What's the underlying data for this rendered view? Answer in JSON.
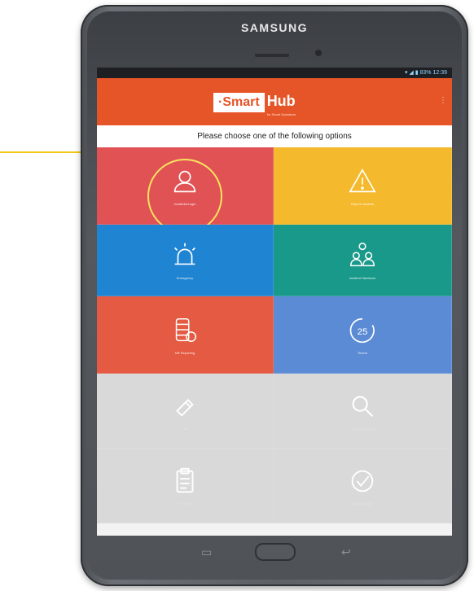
{
  "device": {
    "brand": "SAMSUNG"
  },
  "status_bar": {
    "text": "▾ ◢ ▮ 83% 12:39"
  },
  "app_bar": {
    "logo_smart": "·Smart",
    "logo_hub": "Hub",
    "logo_sub": "for Smart Operators"
  },
  "prompt": "Please choose one of the following options",
  "tiles": [
    {
      "label": "Incidents/Login",
      "icon": "person-icon",
      "color": "#e15255"
    },
    {
      "label": "Report Hazards",
      "icon": "warning-icon",
      "color": "#f4b92c"
    },
    {
      "label": "Emergency",
      "icon": "alarm-light-icon",
      "color": "#1f84d2"
    },
    {
      "label": "Incident Handover",
      "icon": "group-icon",
      "color": "#19998a"
    },
    {
      "label": "NR Reporting",
      "icon": "database-icon",
      "color": "#e45a42"
    },
    {
      "label": "25",
      "caption": "Timers",
      "icon": "timer-25-icon",
      "color": "#5b8bd4"
    },
    {
      "label": "Logs",
      "icon": "pencil-icon",
      "color": "#d9d9d9"
    },
    {
      "label": "Search Incidents",
      "icon": "search-icon",
      "color": "#d9d9d9"
    },
    {
      "label": "Checklist",
      "icon": "clipboard-icon",
      "color": "#d9d9d9"
    },
    {
      "label": "Acknowledge",
      "icon": "check-circle-icon",
      "color": "#d9d9d9"
    }
  ]
}
